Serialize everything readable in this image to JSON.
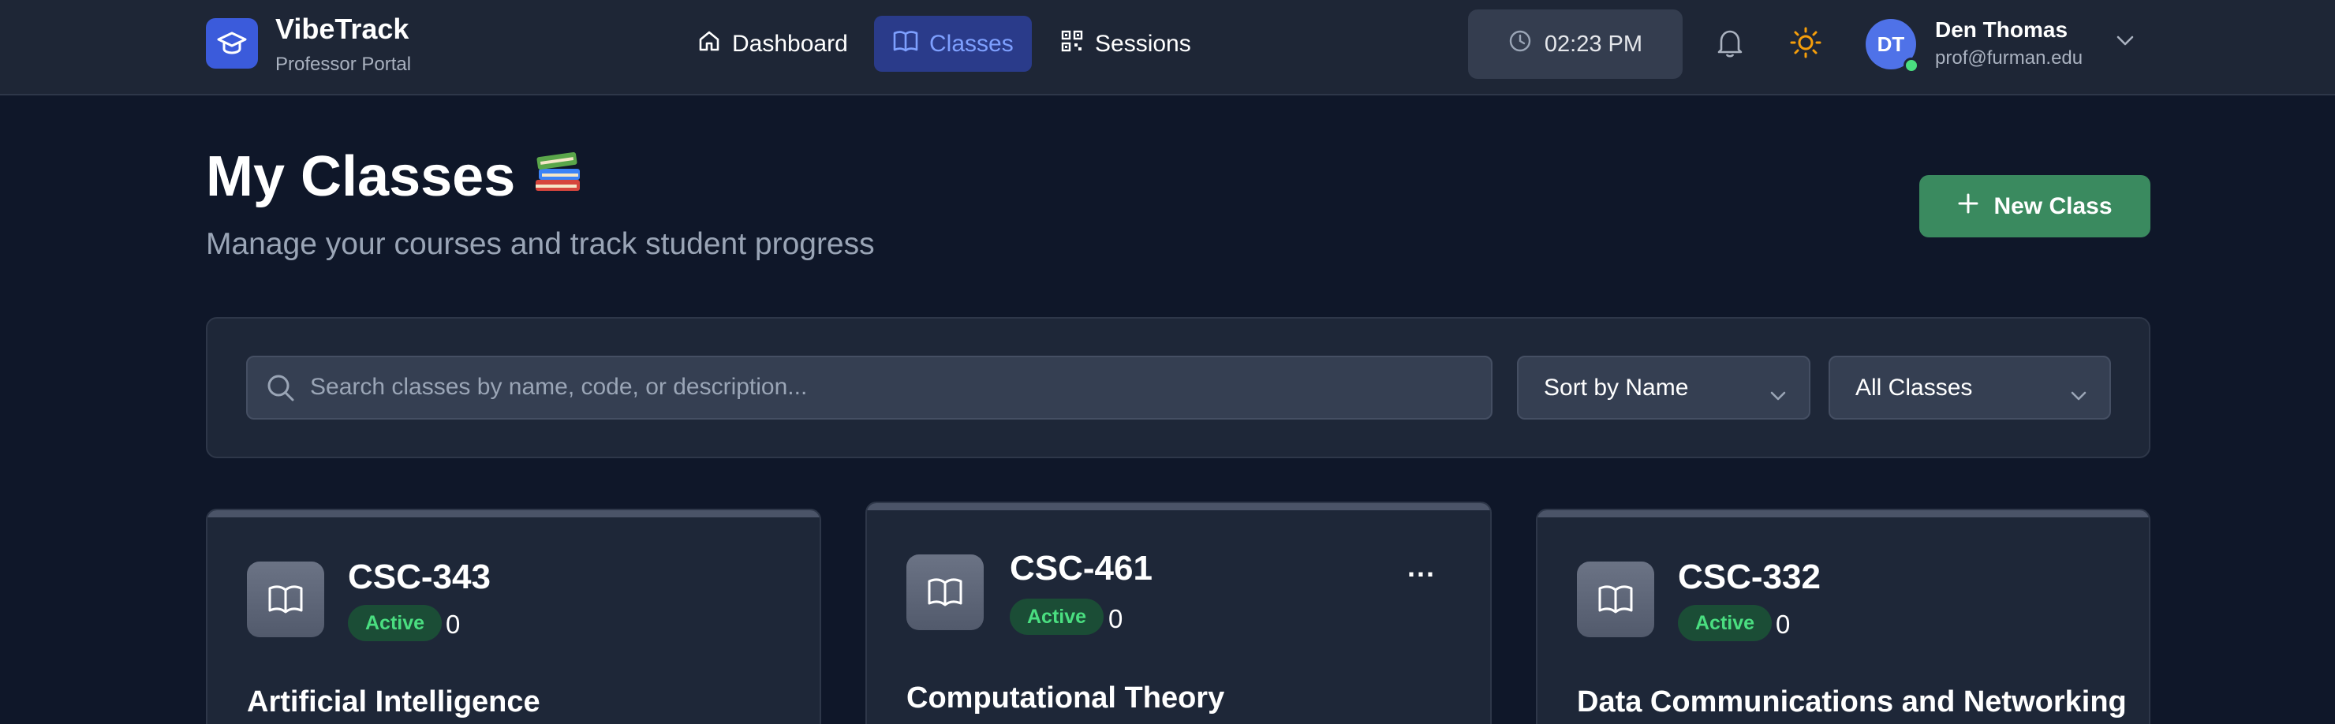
{
  "brand": {
    "title": "VibeTrack",
    "subtitle": "Professor Portal"
  },
  "nav": [
    {
      "label": "Dashboard",
      "icon": "home-icon",
      "active": false
    },
    {
      "label": "Classes",
      "icon": "book-icon",
      "active": true
    },
    {
      "label": "Sessions",
      "icon": "qr-code-icon",
      "active": false
    }
  ],
  "clock": {
    "time": "02:23 PM"
  },
  "user": {
    "initials": "DT",
    "name": "Den Thomas",
    "email": "prof@furman.edu"
  },
  "header": {
    "title": "My Classes",
    "emoji": "📚",
    "subtitle": "Manage your courses and track student progress"
  },
  "new_class_button": {
    "label": "New Class"
  },
  "search": {
    "placeholder": "Search classes by name, code, or description..."
  },
  "sort": {
    "selected": "Sort by Name"
  },
  "filter": {
    "selected": "All Classes"
  },
  "classes": [
    {
      "code": "CSC-343",
      "status": "Active",
      "count": "0",
      "name": "Artificial Intelligence"
    },
    {
      "code": "CSC-461",
      "status": "Active",
      "count": "0",
      "name": "Computational Theory",
      "menu": "..."
    },
    {
      "code": "CSC-332",
      "status": "Active",
      "count": "0",
      "name": "Data Communications and Networking"
    }
  ],
  "colors": {
    "background": "#0f1729",
    "navbar": "#1e2636",
    "accent_blue": "#3b5bdb",
    "active_nav": "#2a3b8a",
    "success_green": "#3a8a5f",
    "badge_green": "#4ade80",
    "sun_yellow": "#f59e0b"
  }
}
